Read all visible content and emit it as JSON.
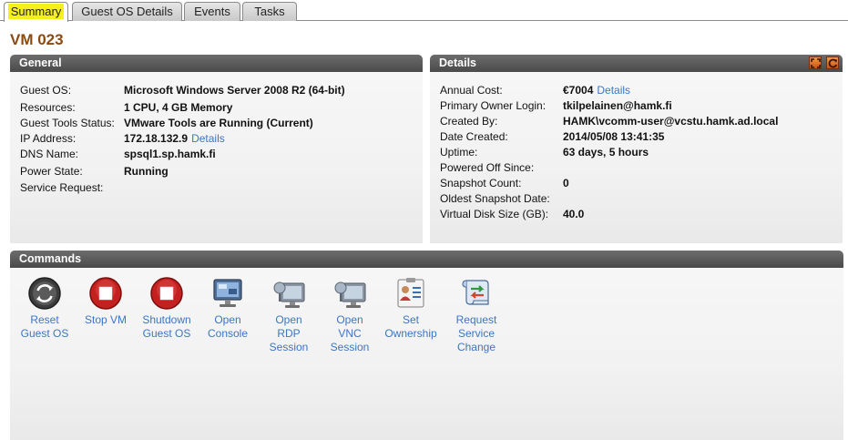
{
  "tabs": [
    {
      "label": "Summary",
      "active": true
    },
    {
      "label": "Guest OS Details",
      "active": false
    },
    {
      "label": "Events",
      "active": false
    },
    {
      "label": "Tasks",
      "active": false
    }
  ],
  "vm_title": "VM 023",
  "general": {
    "header": "General",
    "rows": [
      {
        "key": "Guest OS:",
        "value": "Microsoft Windows Server 2008 R2 (64-bit)"
      },
      {
        "key": "Resources:",
        "value": "1 CPU, 4 GB Memory"
      },
      {
        "key": "Guest Tools Status:",
        "value": "VMware Tools are Running (Current)"
      },
      {
        "key": "IP Address:",
        "value": "172.18.132.9",
        "link": "Details"
      },
      {
        "key": "DNS Name:",
        "value": "spsql1.sp.hamk.fi"
      },
      {
        "key": "Power State:",
        "value": "Running"
      },
      {
        "key": "Service Request:",
        "value": ""
      }
    ]
  },
  "details": {
    "header": "Details",
    "rows": [
      {
        "key": "Annual Cost:",
        "value": "€7004",
        "link": "Details"
      },
      {
        "key": "Primary Owner Login:",
        "value": "tkilpelainen@hamk.fi"
      },
      {
        "key": "Created By:",
        "value": "HAMK\\vcomm-user@vcstu.hamk.ad.local"
      },
      {
        "key": "Date Created:",
        "value": "2014/05/08 13:41:35"
      },
      {
        "key": "Uptime:",
        "value": "63 days, 5 hours"
      },
      {
        "key": "Powered Off Since:",
        "value": ""
      },
      {
        "key": "Snapshot Count:",
        "value": "0"
      },
      {
        "key": "Oldest Snapshot Date:",
        "value": ""
      },
      {
        "key": "Virtual Disk Size (GB):",
        "value": "40.0"
      }
    ],
    "header_icons": [
      "maximize-icon",
      "refresh-icon"
    ]
  },
  "commands": {
    "header": "Commands",
    "items": [
      {
        "label": "Reset\nGuest OS",
        "icon": "reset-icon"
      },
      {
        "label": "Stop VM",
        "icon": "stop-icon"
      },
      {
        "label": "Shutdown\nGuest OS",
        "icon": "shutdown-icon"
      },
      {
        "label": "Open\nConsole",
        "icon": "console-icon"
      },
      {
        "label": "Open\nRDP\nSession",
        "icon": "rdp-icon"
      },
      {
        "label": "Open\nVNC\nSession",
        "icon": "vnc-icon"
      },
      {
        "label": "Set\nOwnership",
        "icon": "ownership-icon"
      },
      {
        "label": "Request\nService\nChange",
        "icon": "service-change-icon"
      }
    ]
  },
  "colors": {
    "title": "#8d4a10",
    "link": "#3b76c4",
    "active_tab_highlight": "#f6f01a",
    "header_bg": "#555555",
    "stop_red": "#c42020"
  }
}
